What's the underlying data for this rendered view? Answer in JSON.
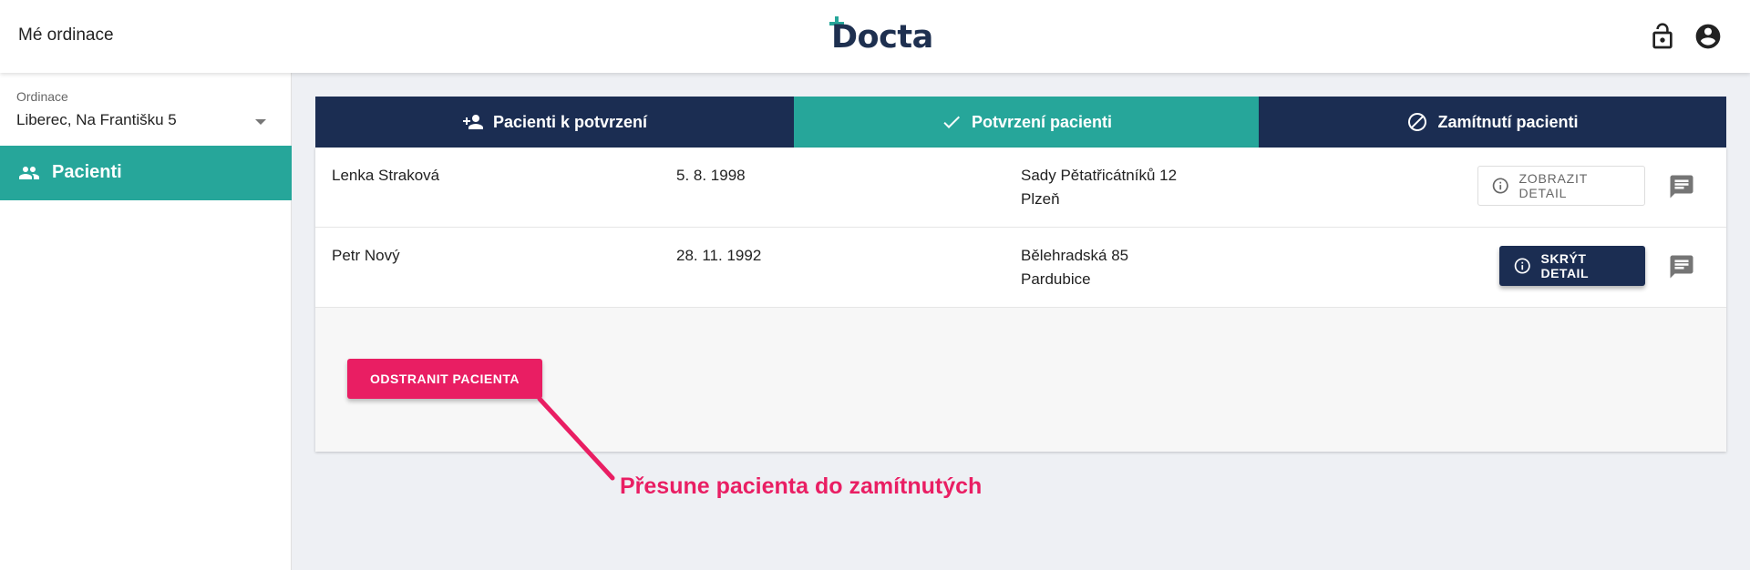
{
  "header": {
    "app_title": "Mé ordinace",
    "logo_text": "Docta",
    "icons": [
      "lock-open-icon",
      "account-circle-icon"
    ]
  },
  "sidebar": {
    "select_label": "Ordinace",
    "select_value": "Liberec, Na Františku 5",
    "nav": [
      {
        "label": "Pacienti",
        "icon": "people-icon",
        "active": true
      }
    ]
  },
  "tabs": [
    {
      "label": "Pacienti k potvrzení",
      "icon": "person-add-icon",
      "active": false
    },
    {
      "label": "Potvrzení pacienti",
      "icon": "check-icon",
      "active": true
    },
    {
      "label": "Zamítnutí pacienti",
      "icon": "block-icon",
      "active": false
    }
  ],
  "patients": [
    {
      "name": "Lenka Straková",
      "birth": "5. 8. 1998",
      "street": "Sady Pětatřicátníků 12",
      "city": "Plzeň",
      "button": "ZOBRAZIT DETAIL"
    },
    {
      "name": "Petr Nový",
      "birth": "28. 11. 1992",
      "street": "Bělehradská 85",
      "city": "Pardubice",
      "button": "SKRÝT DETAIL"
    }
  ],
  "detail": {
    "remove_button": "ODSTRANIT PACIENTA"
  },
  "annotation": {
    "text": "Přesune pacienta do zamítnutých"
  },
  "colors": {
    "primary": "#26a69a",
    "dark": "#1b2d52",
    "accent": "#e91e63"
  }
}
